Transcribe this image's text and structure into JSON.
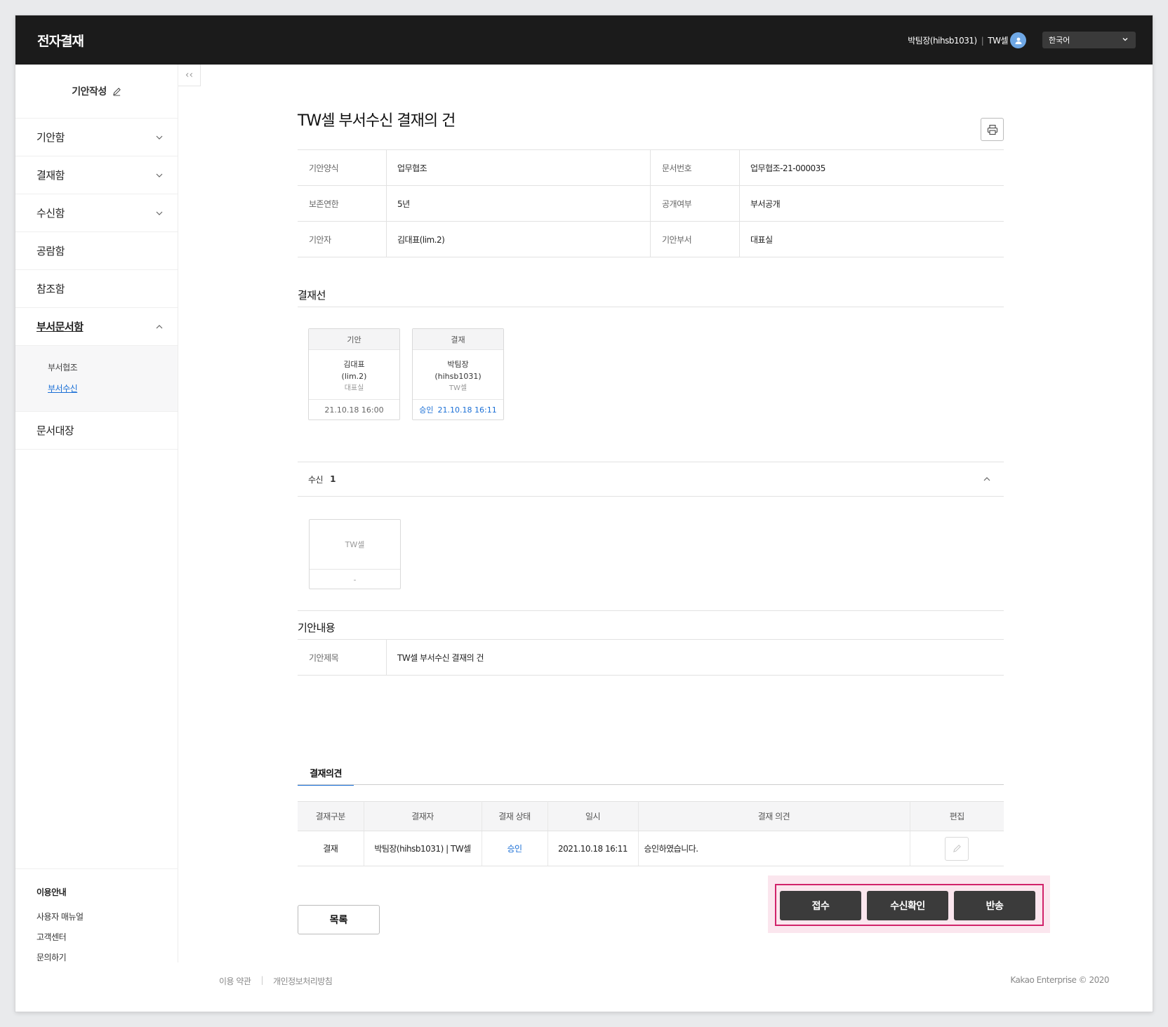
{
  "app": {
    "title": "전자결재"
  },
  "header": {
    "user": "박팀장(hihsb1031)",
    "separator": "|",
    "team": "TW셀",
    "language": "한국어"
  },
  "sidebar": {
    "draft_label": "기안작성",
    "items": [
      {
        "label": "기안함"
      },
      {
        "label": "결재함"
      },
      {
        "label": "수신함"
      },
      {
        "label": "공람함"
      },
      {
        "label": "참조함"
      },
      {
        "label": "부서문서함"
      },
      {
        "label": "문서대장"
      }
    ],
    "submenu": [
      {
        "label": "부서협조"
      },
      {
        "label": "부서수신"
      }
    ],
    "guide": {
      "heading": "이용안내",
      "links": [
        "사용자 매뉴얼",
        "고객센터",
        "문의하기"
      ]
    },
    "collapse_glyph": "‹‹"
  },
  "document": {
    "title": "TW셀 부서수신 결재의 건",
    "info": [
      {
        "label": "기안양식",
        "value": "업무협조",
        "label2": "문서번호",
        "value2": "업무협조-21-000035"
      },
      {
        "label": "보존연한",
        "value": "5년",
        "label2": "공개여부",
        "value2": "부서공개"
      },
      {
        "label": "기안자",
        "value": "김대표(lim.2)",
        "label2": "기안부서",
        "value2": "대표실"
      }
    ]
  },
  "approval_line": {
    "heading": "결재선",
    "cards": [
      {
        "type": "기안",
        "name": "김대표",
        "id": "(lim.2)",
        "dept": "대표실",
        "status": "",
        "time": "21.10.18 16:00"
      },
      {
        "type": "결재",
        "name": "박팀장",
        "id": "(hihsb1031)",
        "dept": "TW셀",
        "status": "승인",
        "time": "21.10.18 16:11"
      }
    ]
  },
  "receive": {
    "label": "수신",
    "count": "1",
    "card": {
      "name": "TW셀",
      "value": "-"
    }
  },
  "content_section": {
    "heading": "기안내용",
    "subject_label": "기안제목",
    "subject_value": "TW셀 부서수신 결재의 건"
  },
  "opinions": {
    "tab": "결재의견",
    "columns": [
      "결재구분",
      "결재자",
      "결재 상태",
      "일시",
      "결재 의견",
      "편집"
    ],
    "rows": [
      {
        "type": "결재",
        "approver": "박팀장(hihsb1031) | TW셀",
        "status": "승인",
        "datetime": "2021.10.18 16:11",
        "opinion": "승인하였습니다."
      }
    ]
  },
  "buttons": {
    "list": "목록",
    "accept": "접수",
    "confirm": "수신확인",
    "return": "반송"
  },
  "footer": {
    "terms": "이용 약관",
    "privacy": "개인정보처리방침",
    "copyright": "Kakao Enterprise © 2020"
  },
  "colors": {
    "topbar": "#1b1b1b",
    "accent": "#1a6fd6",
    "highlight_border": "#d1236a",
    "action_button": "#3b3b3b"
  }
}
